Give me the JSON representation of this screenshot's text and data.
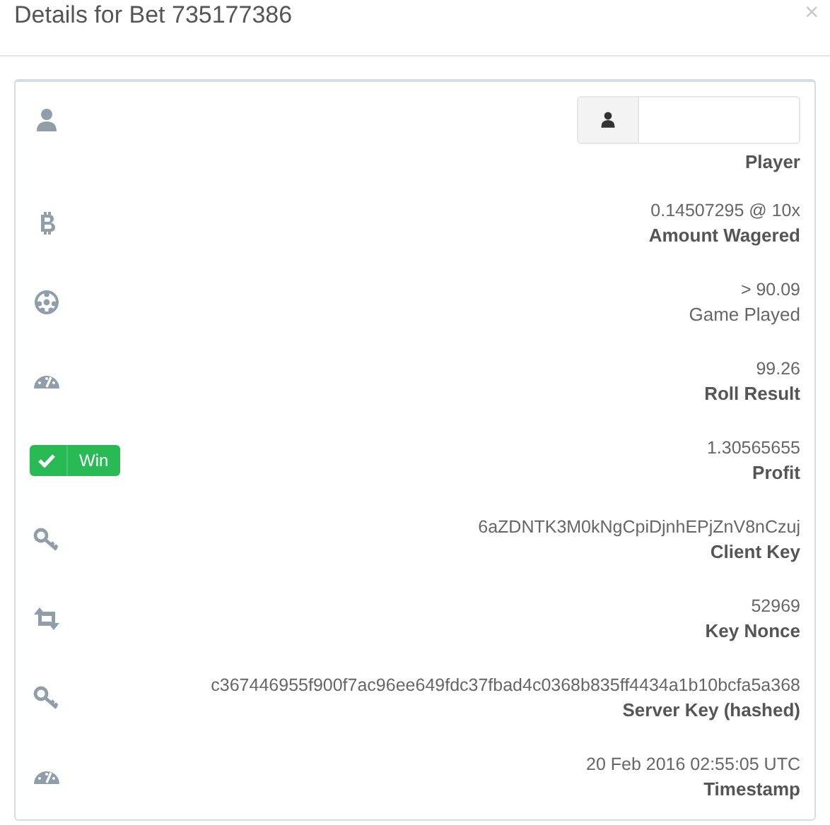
{
  "title": "Details for Bet 735177386",
  "close": "×",
  "rows": [
    {
      "kind": "player",
      "label": "Player",
      "label_bold": true
    },
    {
      "kind": "bitcoin",
      "value": "0.14507295 @ 10x",
      "label": "Amount Wagered",
      "label_bold": true
    },
    {
      "kind": "ball",
      "value": "> 90.09",
      "label": "Game Played",
      "label_bold": false
    },
    {
      "kind": "gauge",
      "value": "99.26",
      "label": "Roll Result",
      "label_bold": true
    },
    {
      "kind": "badge",
      "badge": {
        "text": "Win",
        "color": "#29b955"
      },
      "value": "1.30565655",
      "label": "Profit",
      "label_bold": true
    },
    {
      "kind": "key",
      "value": "6aZDNTK3M0kNgCpiDjnhEPjZnV8nCzuj",
      "label": "Client Key",
      "label_bold": true
    },
    {
      "kind": "repeat",
      "value": "52969",
      "label": "Key Nonce",
      "label_bold": true
    },
    {
      "kind": "key",
      "value": "c367446955f900f7ac96ee649fdc37fbad4c0368b835ff4434a1b10bcfa5a368",
      "label": "Server Key (hashed)",
      "label_bold": true
    },
    {
      "kind": "gauge",
      "value": "20 Feb 2016 02:55:05 UTC",
      "label": "Timestamp",
      "label_bold": true
    }
  ]
}
